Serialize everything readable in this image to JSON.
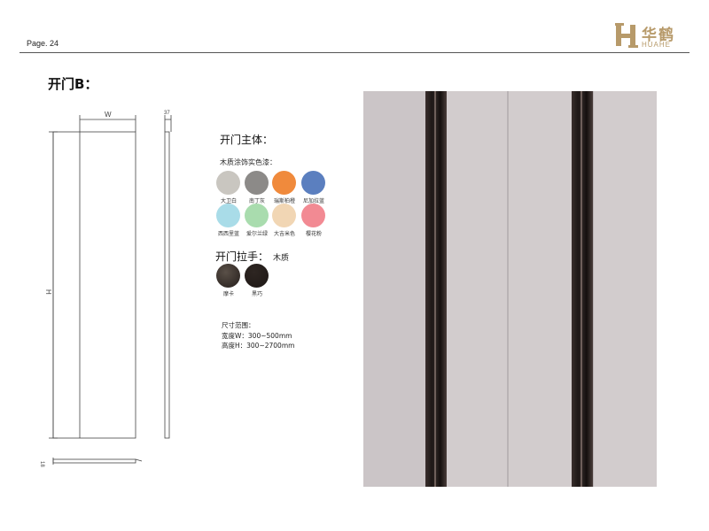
{
  "header": {
    "page_label": "Page. 24",
    "logo_cn": "华鹤",
    "logo_en": "HUAHE",
    "brand_color": "#b79a6a"
  },
  "title": "开门B：",
  "drawing": {
    "width_label": "W",
    "height_label": "H",
    "depth_label": "37",
    "bottom_label": "18"
  },
  "body_section": {
    "title": "开门主体：",
    "finish_label": "木质涂饰实色漆：",
    "colors": [
      {
        "name": "大卫白",
        "color": "#c9c6c0"
      },
      {
        "name": "南丁灰",
        "color": "#8c8a88"
      },
      {
        "name": "瑞斯柏橙",
        "color": "#f08a3c"
      },
      {
        "name": "尼加拉蓝",
        "color": "#5b7fbf"
      },
      {
        "name": "西西里蓝",
        "color": "#a9dce8"
      },
      {
        "name": "爱尔兰绿",
        "color": "#a9dcae"
      },
      {
        "name": "大吉米色",
        "color": "#f1d6b4"
      },
      {
        "name": "樱花粉",
        "color": "#f28a93"
      }
    ]
  },
  "handle_section": {
    "title": "开门拉手：",
    "material": "木质",
    "options": [
      {
        "name": "摩卡",
        "color": "#5a5048"
      },
      {
        "name": "黑巧",
        "color": "#2e2622"
      }
    ]
  },
  "size_range": {
    "title": "尺寸范围：",
    "width": "宽度W：300~500mm",
    "height": "高度H：300~2700mm"
  }
}
